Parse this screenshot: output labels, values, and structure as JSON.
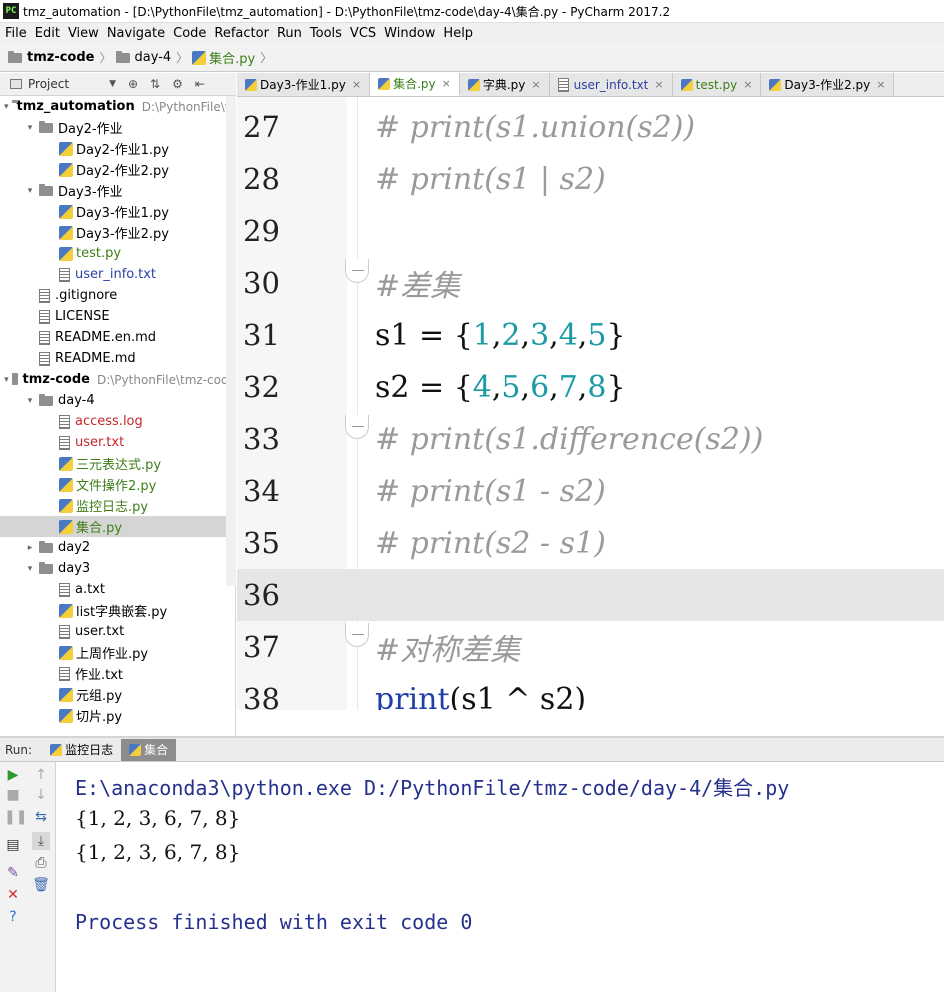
{
  "window": {
    "app_icon": "PC",
    "title": "tmz_automation - [D:\\PythonFile\\tmz_automation] - D:\\PythonFile\\tmz-code\\day-4\\集合.py - PyCharm 2017.2"
  },
  "menu": [
    "File",
    "Edit",
    "View",
    "Navigate",
    "Code",
    "Refactor",
    "Run",
    "Tools",
    "VCS",
    "Window",
    "Help"
  ],
  "breadcrumb": [
    "tmz-code",
    "day-4",
    "集合.py"
  ],
  "project_panel": {
    "label": "Project",
    "tree": [
      {
        "indent": 0,
        "arrow": "▾",
        "icon": "folder",
        "label": "tmz_automation",
        "path": "D:\\PythonFile\\tmz_automation",
        "bold": true,
        "color": ""
      },
      {
        "indent": 1,
        "arrow": "▾",
        "icon": "folder",
        "label": "Day2-作业",
        "color": ""
      },
      {
        "indent": 2,
        "arrow": "",
        "icon": "py",
        "label": "Day2-作业1.py",
        "color": ""
      },
      {
        "indent": 2,
        "arrow": "",
        "icon": "py",
        "label": "Day2-作业2.py",
        "color": ""
      },
      {
        "indent": 1,
        "arrow": "▾",
        "icon": "folder",
        "label": "Day3-作业",
        "color": ""
      },
      {
        "indent": 2,
        "arrow": "",
        "icon": "py",
        "label": "Day3-作业1.py",
        "color": ""
      },
      {
        "indent": 2,
        "arrow": "",
        "icon": "py",
        "label": "Day3-作业2.py",
        "color": ""
      },
      {
        "indent": 2,
        "arrow": "",
        "icon": "py",
        "label": "test.py",
        "color": "green"
      },
      {
        "indent": 2,
        "arrow": "",
        "icon": "txt",
        "label": "user_info.txt",
        "color": "blue"
      },
      {
        "indent": 1,
        "arrow": "",
        "icon": "txt",
        "label": ".gitignore",
        "color": ""
      },
      {
        "indent": 1,
        "arrow": "",
        "icon": "txt",
        "label": "LICENSE",
        "color": ""
      },
      {
        "indent": 1,
        "arrow": "",
        "icon": "txt",
        "label": "README.en.md",
        "color": ""
      },
      {
        "indent": 1,
        "arrow": "",
        "icon": "txt",
        "label": "README.md",
        "color": ""
      },
      {
        "indent": 0,
        "arrow": "▾",
        "icon": "folder",
        "label": "tmz-code",
        "path": "D:\\PythonFile\\tmz-code",
        "bold": true,
        "color": ""
      },
      {
        "indent": 1,
        "arrow": "▾",
        "icon": "folder",
        "label": "day-4",
        "color": ""
      },
      {
        "indent": 2,
        "arrow": "",
        "icon": "txt",
        "label": "access.log",
        "color": "red"
      },
      {
        "indent": 2,
        "arrow": "",
        "icon": "txt",
        "label": "user.txt",
        "color": "red"
      },
      {
        "indent": 2,
        "arrow": "",
        "icon": "py",
        "label": "三元表达式.py",
        "color": "green"
      },
      {
        "indent": 2,
        "arrow": "",
        "icon": "py",
        "label": "文件操作2.py",
        "color": "green"
      },
      {
        "indent": 2,
        "arrow": "",
        "icon": "py",
        "label": "监控日志.py",
        "color": "green"
      },
      {
        "indent": 2,
        "arrow": "",
        "icon": "py",
        "label": "集合.py",
        "color": "green",
        "selected": true
      },
      {
        "indent": 1,
        "arrow": "▸",
        "icon": "folder",
        "label": "day2",
        "color": ""
      },
      {
        "indent": 1,
        "arrow": "▾",
        "icon": "folder",
        "label": "day3",
        "color": ""
      },
      {
        "indent": 2,
        "arrow": "",
        "icon": "txt",
        "label": "a.txt",
        "color": ""
      },
      {
        "indent": 2,
        "arrow": "",
        "icon": "py",
        "label": "list字典嵌套.py",
        "color": ""
      },
      {
        "indent": 2,
        "arrow": "",
        "icon": "txt",
        "label": "user.txt",
        "color": ""
      },
      {
        "indent": 2,
        "arrow": "",
        "icon": "py",
        "label": "上周作业.py",
        "color": ""
      },
      {
        "indent": 2,
        "arrow": "",
        "icon": "txt",
        "label": "作业.txt",
        "color": ""
      },
      {
        "indent": 2,
        "arrow": "",
        "icon": "py",
        "label": "元组.py",
        "color": ""
      },
      {
        "indent": 2,
        "arrow": "",
        "icon": "py",
        "label": "切片.py",
        "color": ""
      }
    ]
  },
  "tabs": [
    {
      "label": "Day3-作业1.py",
      "active": false,
      "color": ""
    },
    {
      "label": "集合.py",
      "active": true,
      "color": "green"
    },
    {
      "label": "字典.py",
      "active": false,
      "color": ""
    },
    {
      "label": "user_info.txt",
      "active": false,
      "color": "blue",
      "icon": "txt"
    },
    {
      "label": "test.py",
      "active": false,
      "color": "green"
    },
    {
      "label": "Day3-作业2.py",
      "active": false,
      "color": ""
    }
  ],
  "editor": {
    "current_line": 36,
    "lines": [
      {
        "no": "27",
        "tokens": [
          {
            "t": "# print(s1.union(s2))",
            "c": "cmt"
          }
        ]
      },
      {
        "no": "28",
        "tokens": [
          {
            "t": "# print(s1 | s2)",
            "c": "cmt"
          }
        ]
      },
      {
        "no": "29",
        "tokens": []
      },
      {
        "no": "30",
        "fold": true,
        "tokens": [
          {
            "t": "#差集",
            "c": "cmt"
          }
        ]
      },
      {
        "no": "31",
        "tokens": [
          {
            "t": "s1 = {",
            "c": ""
          },
          {
            "t": "1",
            "c": "num"
          },
          {
            "t": ",",
            "c": ""
          },
          {
            "t": "2",
            "c": "num"
          },
          {
            "t": ",",
            "c": ""
          },
          {
            "t": "3",
            "c": "num"
          },
          {
            "t": ",",
            "c": ""
          },
          {
            "t": "4",
            "c": "num"
          },
          {
            "t": ",",
            "c": ""
          },
          {
            "t": "5",
            "c": "num"
          },
          {
            "t": "}",
            "c": ""
          }
        ]
      },
      {
        "no": "32",
        "tokens": [
          {
            "t": "s2 = {",
            "c": ""
          },
          {
            "t": "4",
            "c": "num"
          },
          {
            "t": ",",
            "c": ""
          },
          {
            "t": "5",
            "c": "num"
          },
          {
            "t": ",",
            "c": ""
          },
          {
            "t": "6",
            "c": "num"
          },
          {
            "t": ",",
            "c": ""
          },
          {
            "t": "7",
            "c": "num"
          },
          {
            "t": ",",
            "c": ""
          },
          {
            "t": "8",
            "c": "num"
          },
          {
            "t": "}",
            "c": ""
          }
        ]
      },
      {
        "no": "33",
        "fold": true,
        "tokens": [
          {
            "t": "# print(s1.difference(s2))",
            "c": "cmt"
          }
        ]
      },
      {
        "no": "34",
        "tokens": [
          {
            "t": "# print(s1 - s2)",
            "c": "cmt"
          }
        ]
      },
      {
        "no": "35",
        "tokens": [
          {
            "t": "# print(s2 - s1)",
            "c": "cmt"
          }
        ]
      },
      {
        "no": "36",
        "tokens": []
      },
      {
        "no": "37",
        "fold": true,
        "tokens": [
          {
            "t": "#对称差集",
            "c": "cmt"
          }
        ]
      },
      {
        "no": "38",
        "tokens": [
          {
            "t": "print",
            "c": "kw"
          },
          {
            "t": "(s1 ^ s2)",
            "c": ""
          }
        ]
      }
    ]
  },
  "run_panel": {
    "label": "Run:",
    "tabs": [
      {
        "label": "监控日志",
        "active": false
      },
      {
        "label": "集合",
        "active": true
      }
    ],
    "console": [
      {
        "text": "E:\\anaconda3\\python.exe D:/PythonFile/tmz-code/day-4/集合.py",
        "style": "blue"
      },
      {
        "text": "{1, 2, 3, 6, 7, 8}",
        "style": "black"
      },
      {
        "text": "{1, 2, 3, 6, 7, 8}",
        "style": "black"
      },
      {
        "text": "",
        "style": "black"
      },
      {
        "text": "Process finished with exit code 0",
        "style": "blue"
      }
    ]
  },
  "colors": {
    "green_file": "#3e7e18",
    "blue_file": "#2a3fa6",
    "red_file": "#c62828",
    "comment": "#9a9a9a",
    "number": "#1d9ba5",
    "keyword": "#1f3fa6"
  }
}
